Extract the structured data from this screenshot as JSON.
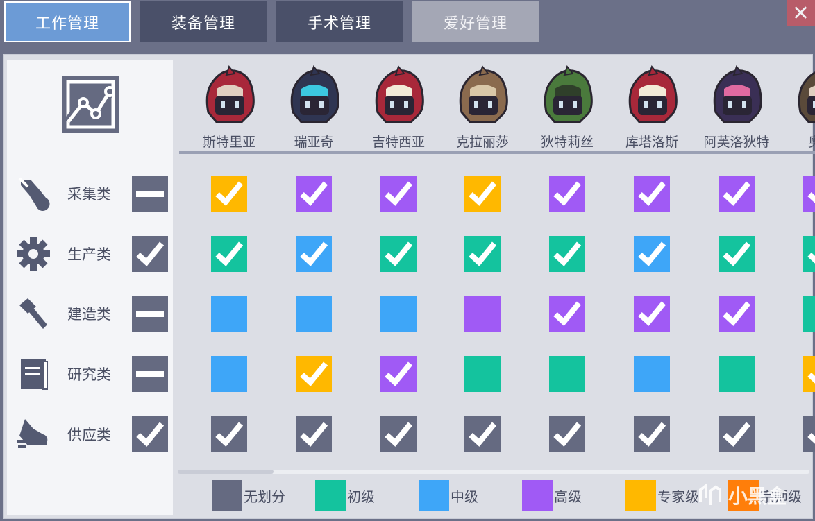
{
  "tabs": [
    {
      "label": "工作管理",
      "state": "active"
    },
    {
      "label": "装备管理",
      "state": "inactive"
    },
    {
      "label": "手术管理",
      "state": "inactive"
    },
    {
      "label": "爱好管理",
      "state": "dim"
    }
  ],
  "close_symbol": "✕",
  "categories": [
    {
      "label": "采集类",
      "icon": "gather-icon",
      "state": "partial"
    },
    {
      "label": "生产类",
      "icon": "gear-icon",
      "state": "checked"
    },
    {
      "label": "建造类",
      "icon": "hammer-icon",
      "state": "partial"
    },
    {
      "label": "研究类",
      "icon": "book-icon",
      "state": "partial"
    },
    {
      "label": "供应类",
      "icon": "shoe-icon",
      "state": "checked"
    }
  ],
  "characters": [
    {
      "name": "斯特里亚",
      "hood": "#a8283a",
      "accent": "#e0cfc0"
    },
    {
      "name": "瑞亚奇",
      "hood": "#2f3552",
      "accent": "#3cc8e0"
    },
    {
      "name": "吉特西亚",
      "hood": "#a8283a",
      "accent": "#f3ead8"
    },
    {
      "name": "克拉丽莎",
      "hood": "#8a6a4e",
      "accent": "#d9c7a8"
    },
    {
      "name": "狄特莉丝",
      "hood": "#4a7a3c",
      "accent": "#2f3f2a"
    },
    {
      "name": "库塔洛斯",
      "hood": "#a8283a",
      "accent": "#f3ead8"
    },
    {
      "name": "阿芙洛狄特",
      "hood": "#3a2f55",
      "accent": "#e06aa0"
    },
    {
      "name": "奥莉",
      "hood": "#5a4a3a",
      "accent": "#e0cfc0"
    }
  ],
  "grid": [
    [
      [
        "expert",
        true
      ],
      [
        "advanced",
        true
      ],
      [
        "advanced",
        true
      ],
      [
        "expert",
        true
      ],
      [
        "advanced",
        true
      ],
      [
        "advanced",
        true
      ],
      [
        "advanced",
        true
      ],
      [
        "advanced",
        true
      ]
    ],
    [
      [
        "beginner",
        true
      ],
      [
        "intermediate",
        true
      ],
      [
        "beginner",
        true
      ],
      [
        "beginner",
        true
      ],
      [
        "beginner",
        true
      ],
      [
        "intermediate",
        true
      ],
      [
        "beginner",
        true
      ],
      [
        "beginner",
        true
      ]
    ],
    [
      [
        "intermediate",
        false
      ],
      [
        "intermediate",
        false
      ],
      [
        "intermediate",
        false
      ],
      [
        "advanced",
        false
      ],
      [
        "advanced",
        true
      ],
      [
        "advanced",
        true
      ],
      [
        "advanced",
        true
      ],
      [
        "beginner",
        false
      ]
    ],
    [
      [
        "intermediate",
        false
      ],
      [
        "expert",
        true
      ],
      [
        "advanced",
        true
      ],
      [
        "beginner",
        false
      ],
      [
        "beginner",
        false
      ],
      [
        "intermediate",
        false
      ],
      [
        "beginner",
        false
      ],
      [
        "expert",
        true
      ]
    ],
    [
      [
        "none",
        true
      ],
      [
        "none",
        true
      ],
      [
        "none",
        true
      ],
      [
        "none",
        true
      ],
      [
        "none",
        true
      ],
      [
        "none",
        true
      ],
      [
        "none",
        true
      ],
      [
        "none",
        true
      ]
    ]
  ],
  "levels": {
    "none": {
      "label": "无划分",
      "color": "#656a81"
    },
    "beginner": {
      "label": "初级",
      "color": "#14c39e"
    },
    "intermediate": {
      "label": "中级",
      "color": "#3ea6f8"
    },
    "advanced": {
      "label": "高级",
      "color": "#a05af5"
    },
    "expert": {
      "label": "专家级",
      "color": "#ffb800"
    },
    "master": {
      "label": "宗师级",
      "color": "#ff7e0a"
    }
  },
  "legend_order": [
    "none",
    "beginner",
    "intermediate",
    "advanced",
    "expert",
    "master"
  ],
  "watermark": {
    "text": "小黑盒",
    "icon": "heybox-logo-icon"
  },
  "colors": {
    "check_bg": "#656a81",
    "panel": "#dcdee5",
    "sidebar": "#f4f5f8"
  }
}
